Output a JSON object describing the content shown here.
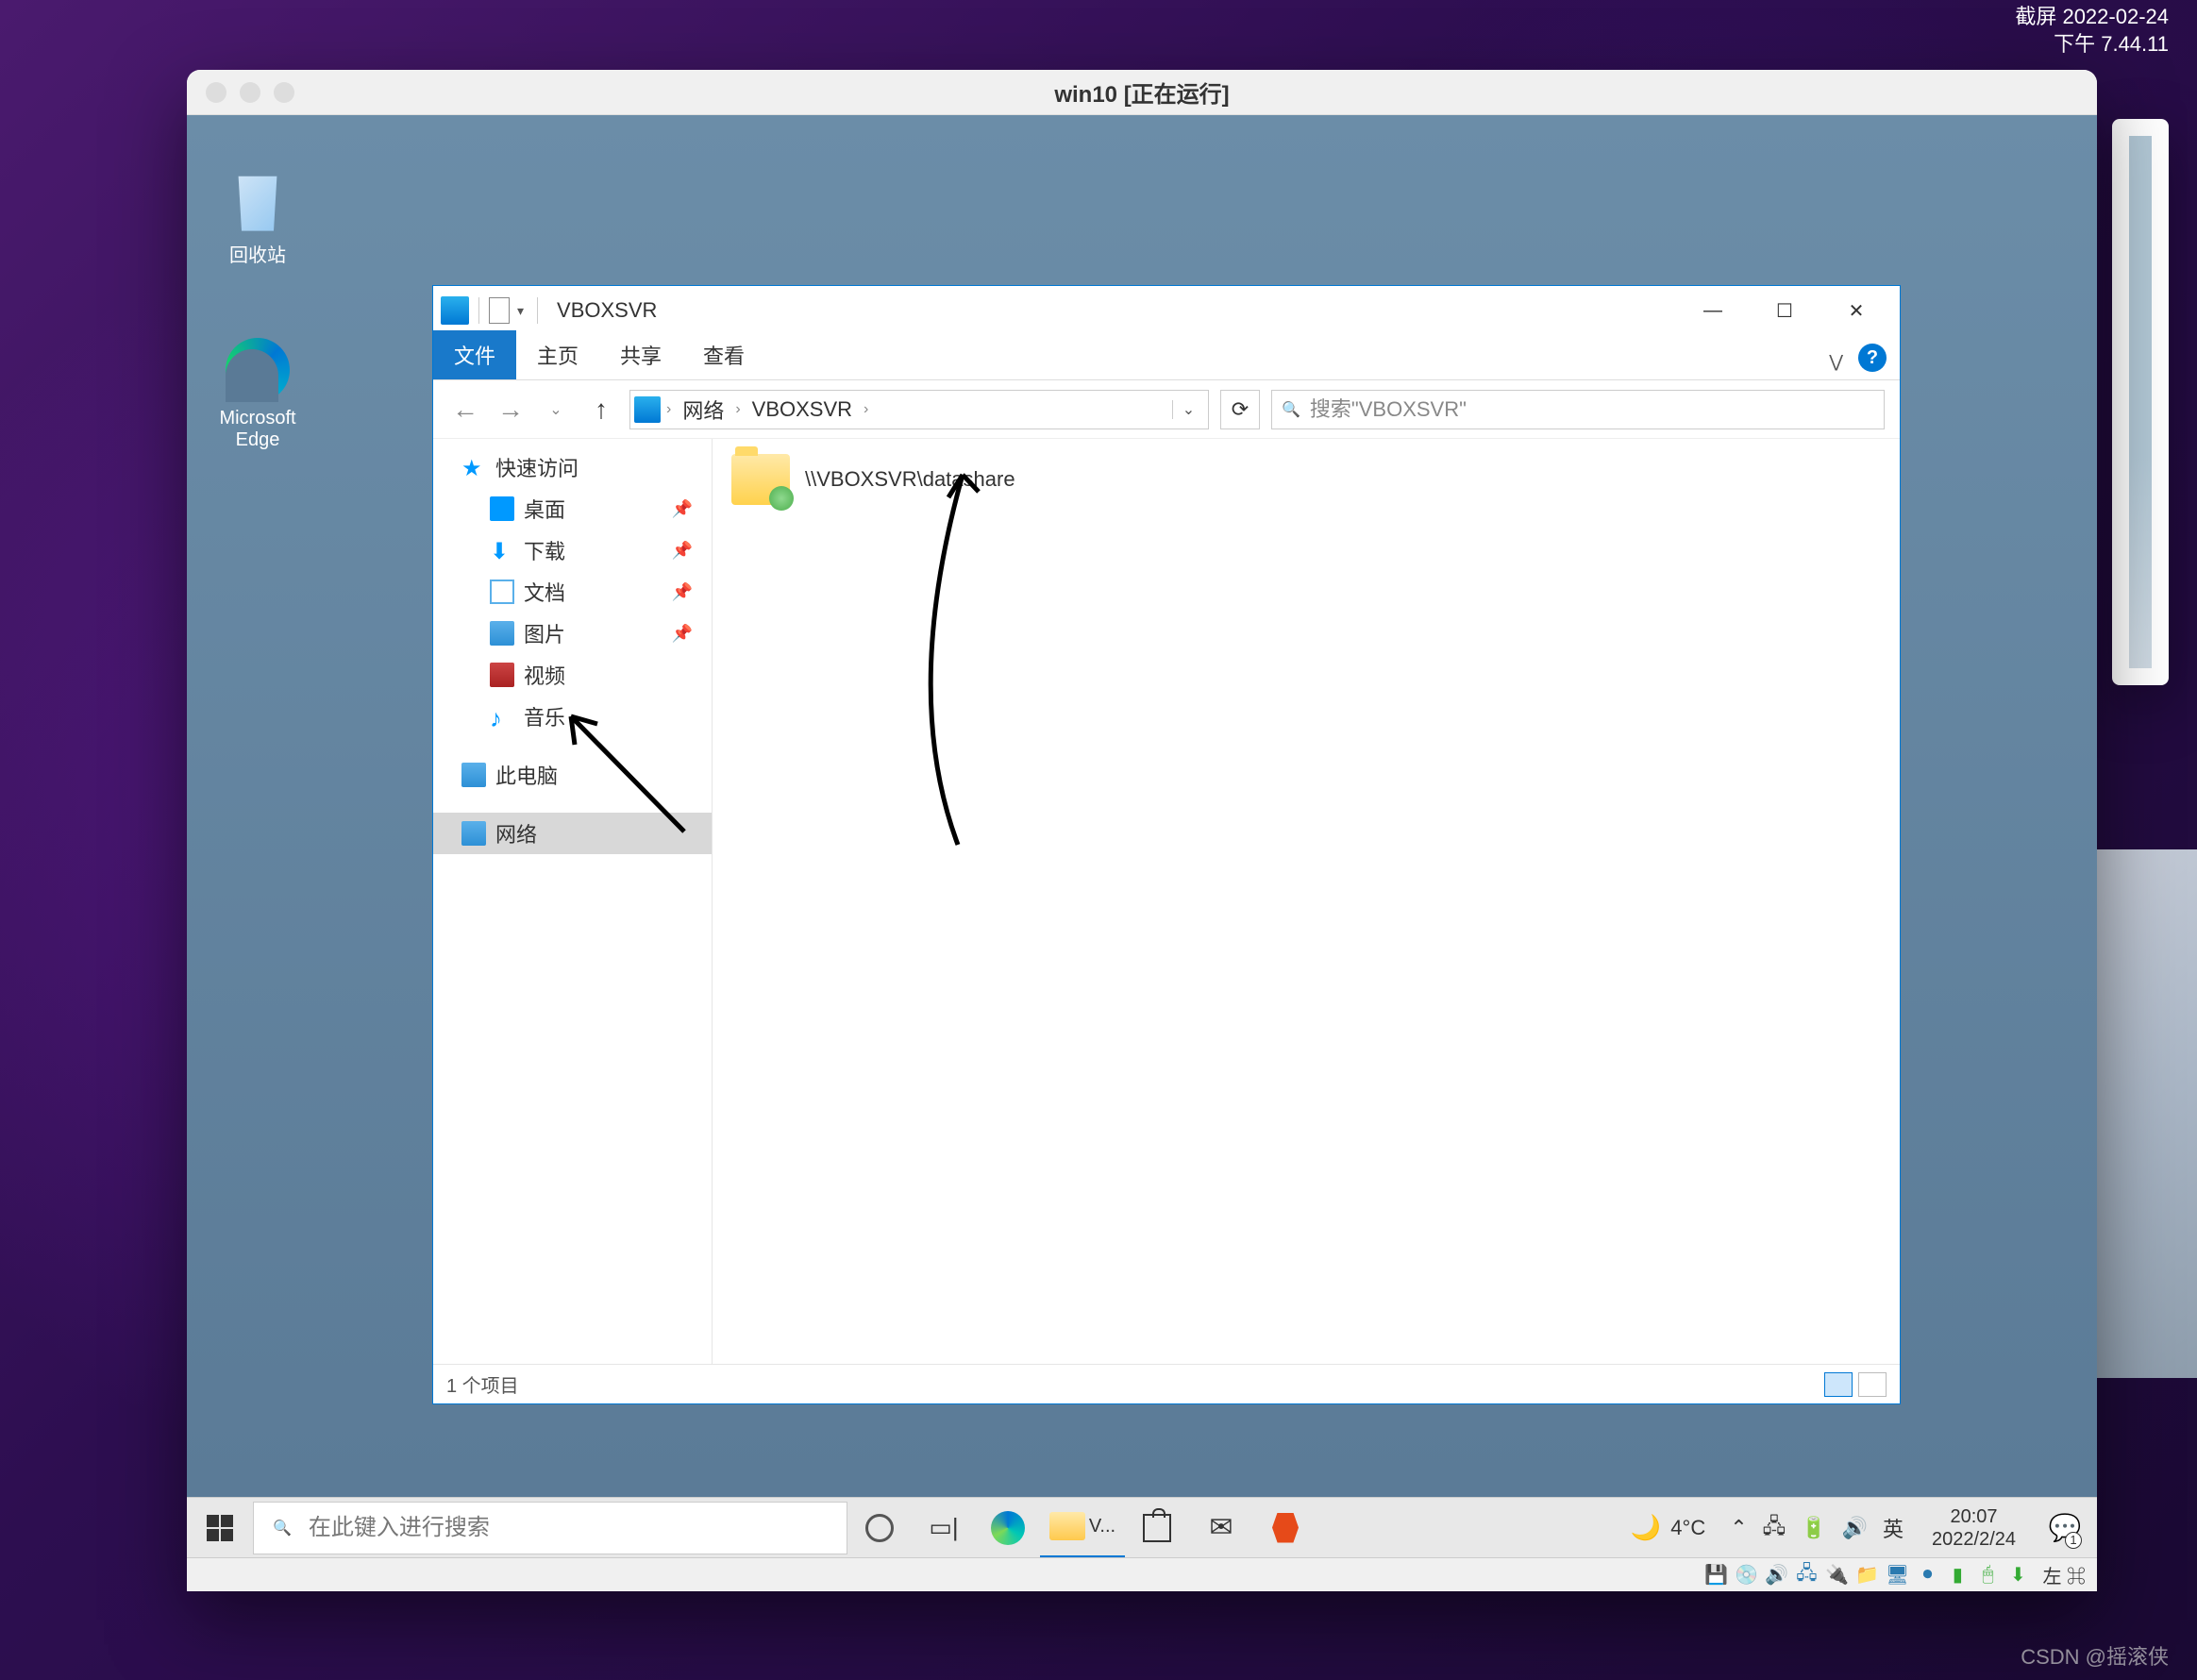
{
  "screenshot_label": {
    "line1": "截屏 2022-02-24",
    "line2": "下午 7.44.11"
  },
  "vm": {
    "title": "win10 [正在运行]",
    "host_key": "左 ⌘"
  },
  "desktop_icons": {
    "recycle_bin": "回收站",
    "edge": "Microsoft Edge"
  },
  "explorer": {
    "title": "VBOXSVR",
    "ribbon": {
      "file": "文件",
      "home": "主页",
      "share": "共享",
      "view": "查看"
    },
    "breadcrumb": {
      "root": "网络",
      "folder": "VBOXSVR"
    },
    "search_placeholder": "搜索\"VBOXSVR\"",
    "nav": {
      "quick_access": "快速访问",
      "desktop": "桌面",
      "downloads": "下载",
      "documents": "文档",
      "pictures": "图片",
      "videos": "视频",
      "music": "音乐",
      "this_pc": "此电脑",
      "network": "网络"
    },
    "content": {
      "share_folder": "\\\\VBOXSVR\\datashare"
    },
    "status": "1 个项目"
  },
  "taskbar": {
    "search_placeholder": "在此键入进行搜索",
    "explorer_label": "V...",
    "weather_temp": "4°C",
    "ime": "英",
    "time": "20:07",
    "date": "2022/2/24",
    "notif_count": "1"
  },
  "watermark": "CSDN @摇滚侠"
}
